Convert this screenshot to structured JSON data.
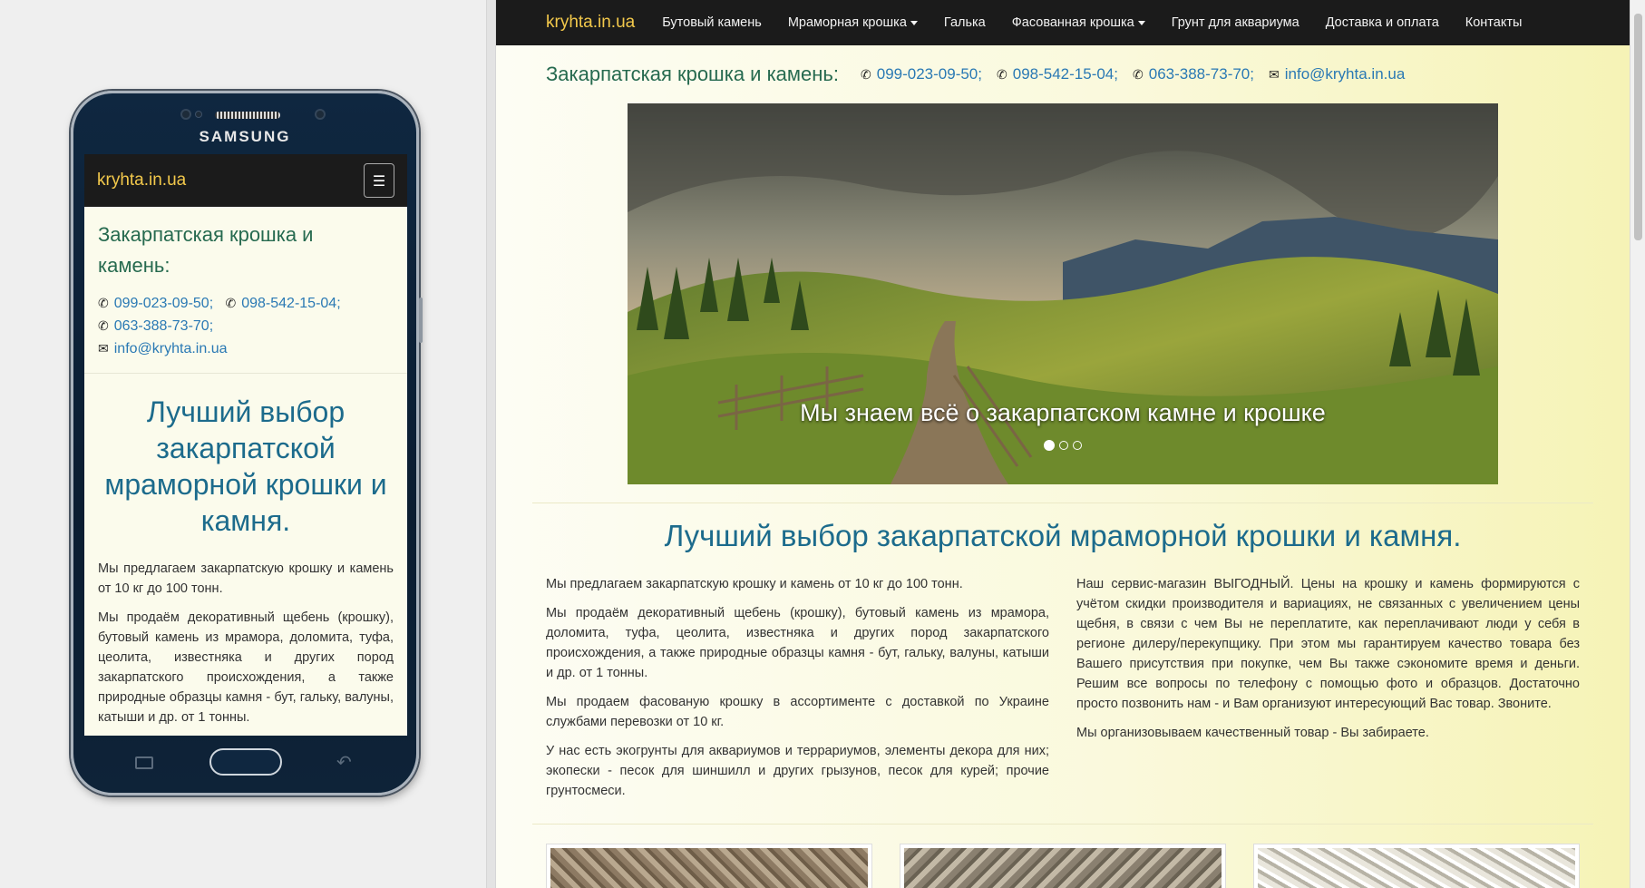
{
  "brand": "kryhta.in.ua",
  "nav": {
    "items": [
      {
        "label": "Бутовый камень",
        "dropdown": false
      },
      {
        "label": "Мраморная крошка",
        "dropdown": true
      },
      {
        "label": "Галька",
        "dropdown": false
      },
      {
        "label": "Фасованная крошка",
        "dropdown": true
      },
      {
        "label": "Грунт для аквариума",
        "dropdown": false
      },
      {
        "label": "Доставка и оплата",
        "dropdown": false
      },
      {
        "label": "Контакты",
        "dropdown": false
      }
    ]
  },
  "contacts": {
    "lead": "Закарпатская крошка и камень:",
    "phone1": "099-023-09-50;",
    "phone2": "098-542-15-04;",
    "phone3": "063-388-73-70;",
    "email": "info@kryhta.in.ua"
  },
  "mobile": {
    "lead_line1": "Закарпатская крошка и",
    "lead_line2": "камень:",
    "h1": "Лучший выбор закарпатской мраморной крошки и камня.",
    "p1": "Мы предлагаем закарпатскую крошку и камень от 10 кг до 100 тонн.",
    "p2": "Мы продаём декоративный щебень (крошку), бутовый камень из мрамора, доломита, туфа, цеолита, известняка и других пород закарпатского происхождения, а также природные образцы камня - бут, гальку, валуны, катыши и др. от 1 тонны.",
    "phone_brand": "SAMSUNG"
  },
  "carousel": {
    "caption": "Мы знаем всё о закарпатском камне и крошке",
    "slides": 3,
    "active": 0,
    "prev": "‹",
    "next": "›"
  },
  "main": {
    "h1": "Лучший выбор закарпатской мраморной крошки и камня.",
    "left": [
      "Мы предлагаем закарпатскую крошку и камень от 10 кг до 100 тонн.",
      "Мы продаём декоративный щебень (крошку), бутовый камень из мрамора, доломита, туфа, цеолита, известняка и других пород закарпатского происхождения, а также природные образцы камня - бут, гальку, валуны, катыши и др. от 1 тонны.",
      "Мы продаем фасованую крошку в ассортименте с доставкой по Украине службами перевозки от 10 кг.",
      "У нас есть экогрунты для аквариумов и террариумов, элементы декора для них; экопески - песок для шиншилл и других грызунов, песок для курей; прочие грунтосмеси."
    ],
    "right": [
      "Наш сервис-магазин ВЫГОДНЫЙ. Цены на крошку и камень формируются с учётом скидки производителя и вариациях, не связанных с увеличением цены щебня, в связи с чем Вы не переплатите, как переплачивают люди у себя в регионе дилеру/перекупщику. При этом мы гарантируем качество товара без Вашего присутствия при покупке, чем Вы также сэкономите время и деньги. Решим все вопросы по телефону с помощью фото и образцов. Достаточно просто позвонить нам - и Вам организуют интересующий Вас товар. Звоните.",
      "Мы организовываем качественный товар - Вы забираете."
    ]
  },
  "icons": {
    "phone": "phone-icon",
    "email": "envelope-icon",
    "menu": "hamburger-icon"
  },
  "colors": {
    "navbar": "#1b1b1b",
    "brand": "#f2c84b",
    "heading": "#1c6b8c",
    "lead": "#266a4f",
    "link": "#2a79b4"
  }
}
